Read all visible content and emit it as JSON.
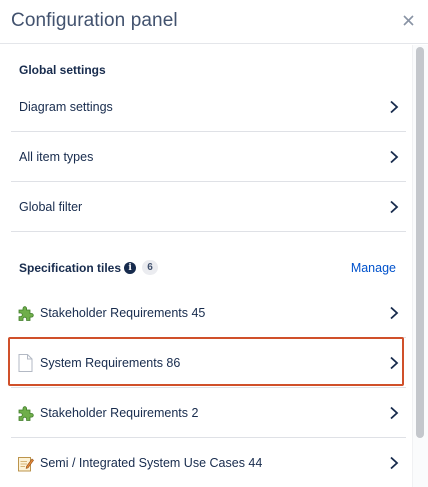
{
  "header": {
    "title": "Configuration panel"
  },
  "global": {
    "title": "Global settings",
    "items": [
      {
        "label": "Diagram settings"
      },
      {
        "label": "All item types"
      },
      {
        "label": "Global filter"
      }
    ]
  },
  "spec": {
    "title": "Specification tiles",
    "count": "6",
    "manage_label": "Manage",
    "tiles": [
      {
        "label": "Stakeholder Requirements 45",
        "icon": "puzzle-icon"
      },
      {
        "label": "System Requirements 86",
        "icon": "document-icon",
        "highlighted": true
      },
      {
        "label": "Stakeholder Requirements 2",
        "icon": "puzzle-icon"
      },
      {
        "label": "Semi / Integrated System Use Cases 44",
        "icon": "notepad-pencil-icon"
      }
    ]
  },
  "colors": {
    "highlight": "#d0502a",
    "link": "#0052cc"
  }
}
